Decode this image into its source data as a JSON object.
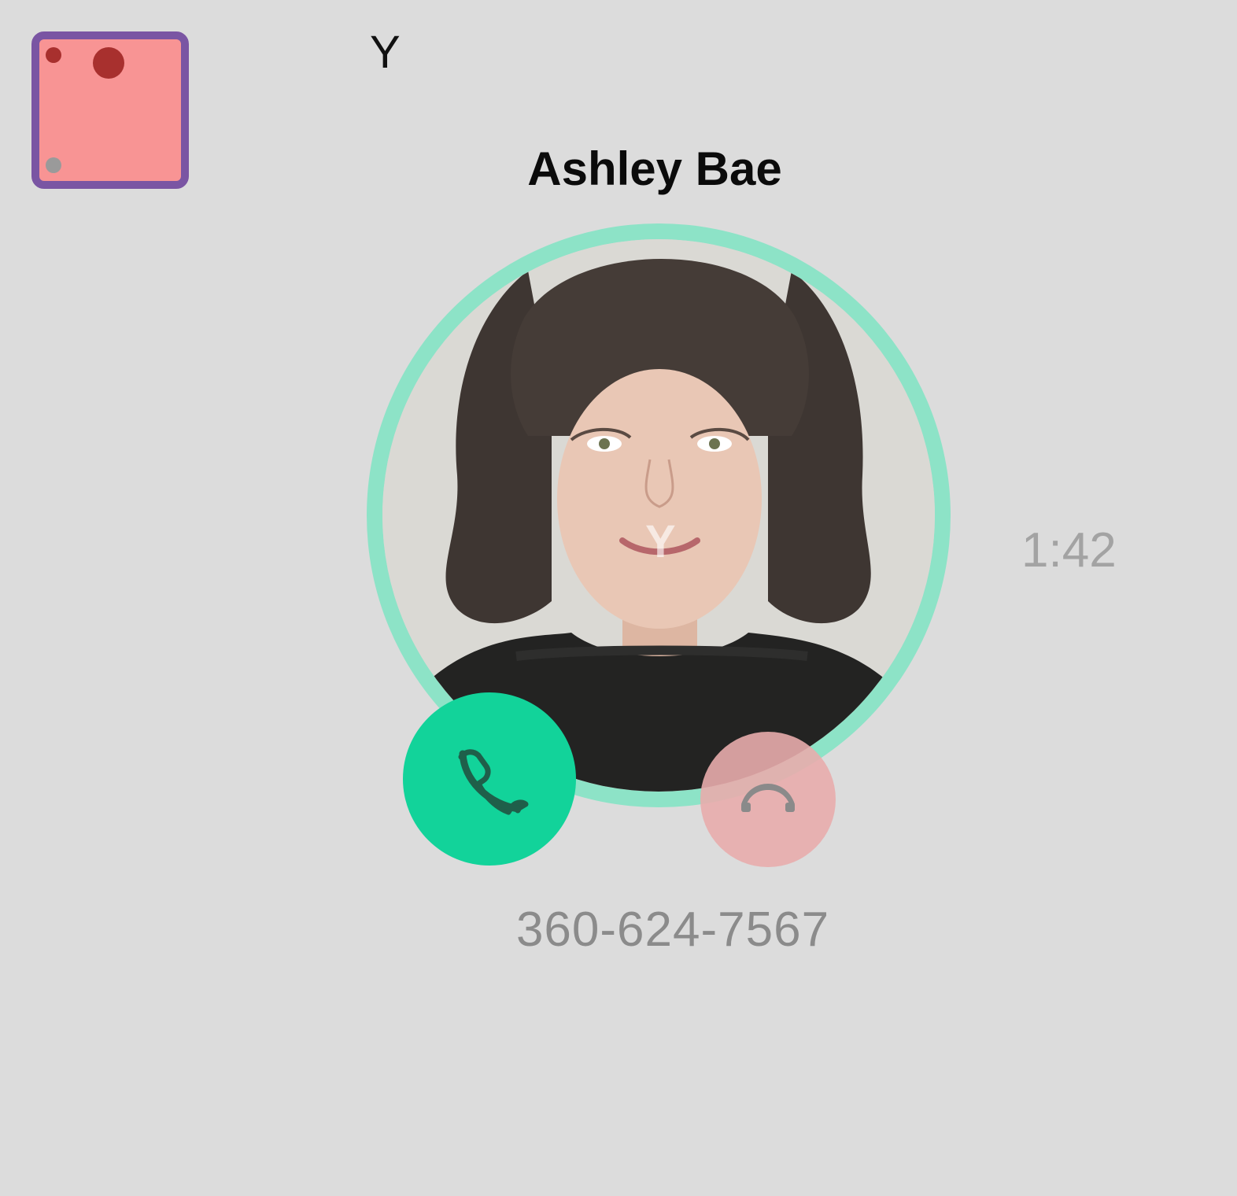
{
  "top_marker": "Y",
  "caller": {
    "name": "Ashley Bae",
    "phone": "360-624-7567",
    "timer": "1:42"
  },
  "avatar_marker": "Y",
  "icons": {
    "accept": "phone-icon",
    "decline": "hangup-icon",
    "badge": "app-badge-icon"
  },
  "colors": {
    "background": "#dcdcdc",
    "ring": "#8de3c7",
    "accept": "#12d39a",
    "decline": "#e8acac",
    "badge_fill": "#f89494",
    "badge_border": "#7a55a3"
  }
}
